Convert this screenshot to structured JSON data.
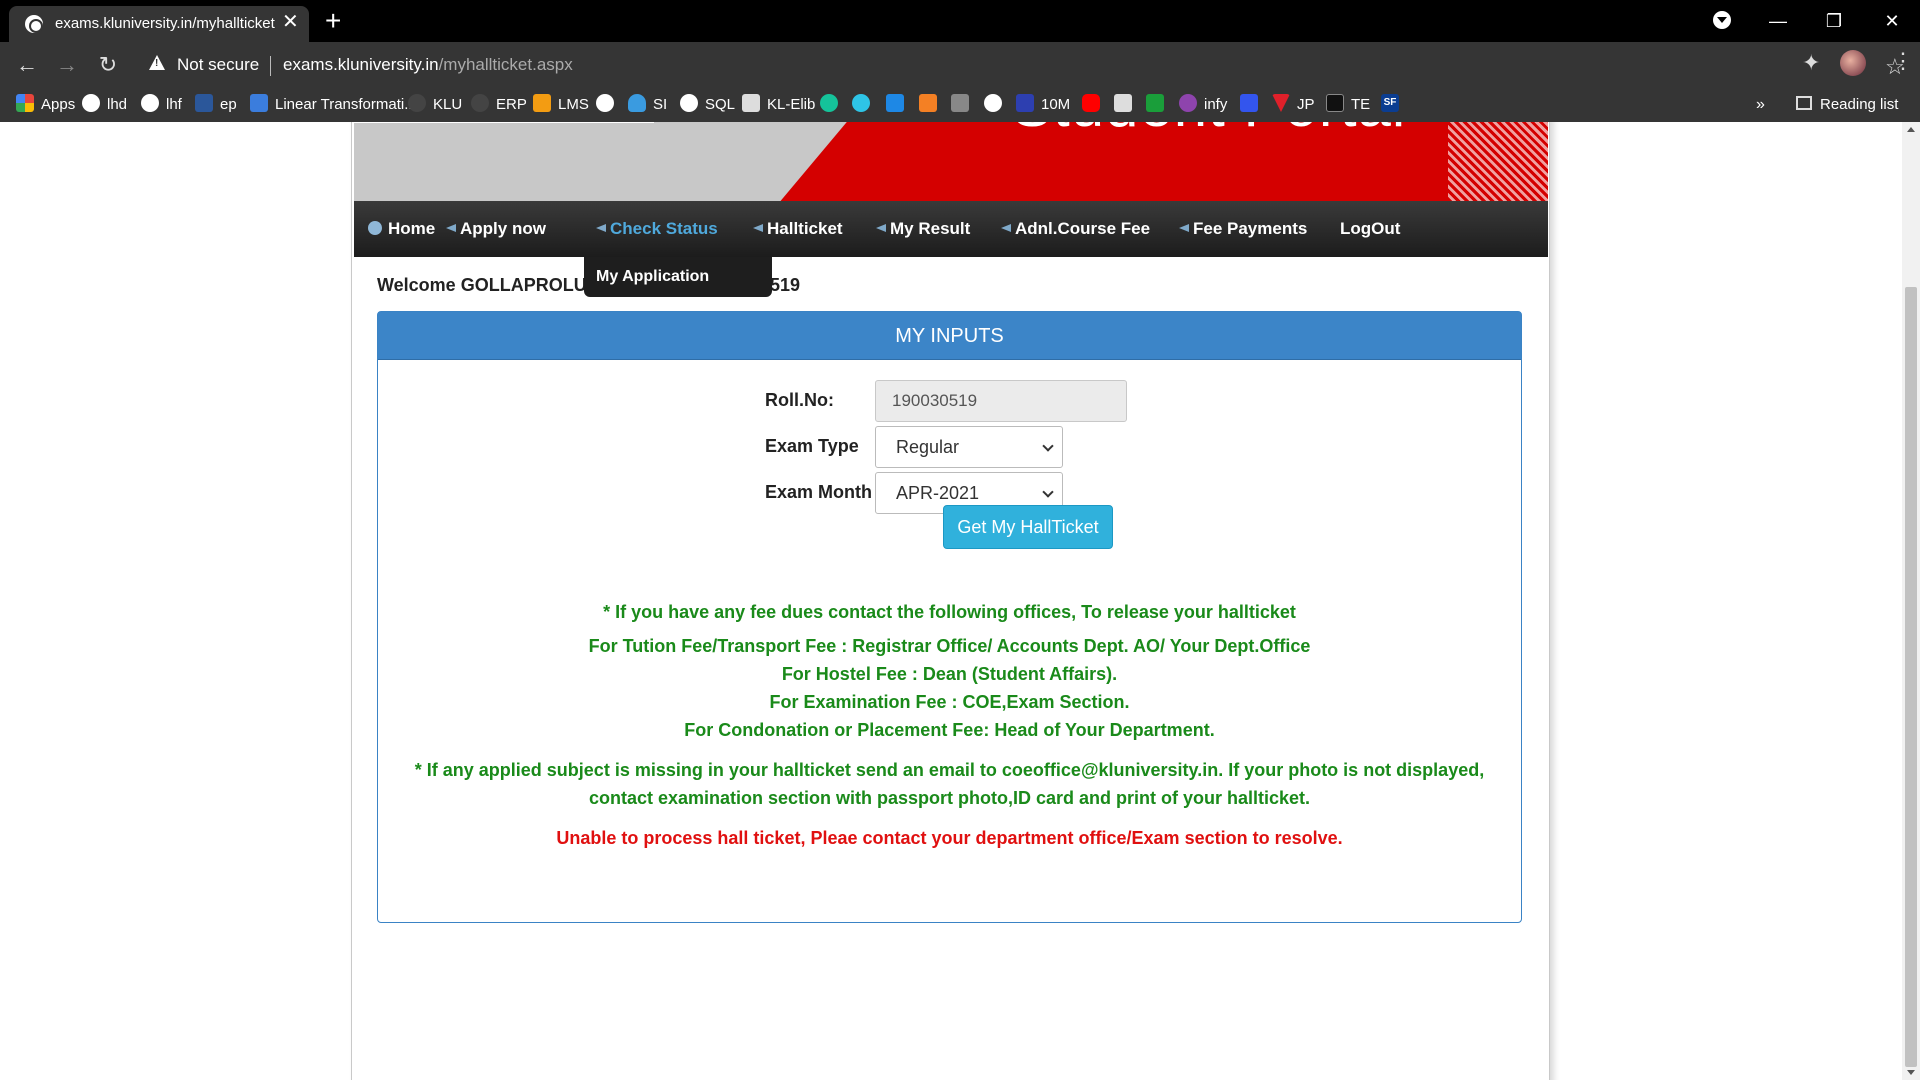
{
  "browser": {
    "tab_title": "exams.kluniversity.in/myhallticket.aspx",
    "close_glyph": "✕",
    "new_tab_glyph": "+",
    "not_secure": "Not secure",
    "url_host": "exams.kluniversity.in",
    "url_path": "/myhallticket.aspx",
    "bookmarks": [
      {
        "label": "Apps",
        "icon": "apps-grid-icon",
        "color": "#e8453c"
      },
      {
        "label": "lhd",
        "icon": "globe-icon",
        "color": "#ffffff"
      },
      {
        "label": "lhf",
        "icon": "globe-icon",
        "color": "#ffffff"
      },
      {
        "label": "ep",
        "icon": "word-icon",
        "color": "#2b579a"
      },
      {
        "label": "Linear Transformati...",
        "icon": "st-icon",
        "color": "#3b7ddd"
      },
      {
        "label": "KLU",
        "icon": "klu-icon",
        "color": "#444444"
      },
      {
        "label": "ERP",
        "icon": "erp-icon",
        "color": "#444444"
      },
      {
        "label": "LMS",
        "icon": "lms-icon",
        "color": "#f39c12"
      },
      {
        "label": "SI",
        "icon": "onedrive-icon",
        "color": "#3a9be0"
      },
      {
        "label": "SQL",
        "icon": "globe-icon",
        "color": "#ffffff"
      },
      {
        "label": "KL-Elib",
        "icon": "elib-icon",
        "color": "#dddddd"
      },
      {
        "label": "10M",
        "icon": "tenm-icon",
        "color": "#2d3fb0"
      },
      {
        "label": "infy",
        "icon": "infy-icon",
        "color": "#8e44ad"
      },
      {
        "label": "JP",
        "icon": "jp-icon",
        "color": "#e0202a"
      },
      {
        "label": "TE",
        "icon": "te-icon",
        "color": "#111111"
      }
    ],
    "bookmark_icons_only": [
      {
        "icon": "grammarly-icon",
        "color": "#15c39a"
      },
      {
        "icon": "chat-icon",
        "color": "#2ec4e6"
      },
      {
        "icon": "box-icon",
        "color": "#1e88e5"
      },
      {
        "icon": "stack-icon",
        "color": "#f48024"
      },
      {
        "icon": "dots-icon",
        "color": "#888888"
      },
      {
        "icon": "globe-icon",
        "color": "#ffffff"
      },
      {
        "icon": "youtube-icon",
        "color": "#ff0000"
      },
      {
        "icon": "hex-icon",
        "color": "#dddddd"
      },
      {
        "icon": "w-icon",
        "color": "#1a9e3a"
      },
      {
        "icon": "pen-icon",
        "color": "#3355ee"
      },
      {
        "icon": "sf-icon",
        "color": "#0b3d91"
      }
    ],
    "sf_label": "SF",
    "overflow": "»",
    "reading_list": "Reading list"
  },
  "portal": {
    "banner_title": "Student Portal",
    "nav": {
      "home": "Home",
      "apply": "Apply now",
      "check_status": "Check Status",
      "hallticket": "Hallticket",
      "my_result": "My Result",
      "course_fee": "Adnl.Course Fee",
      "fee_payments": "Fee Payments",
      "logout": "LogOut"
    },
    "dropdown_item": "My Application",
    "welcome_visible": "Welcome GOLLAPROLU",
    "welcome_tail": "519",
    "panel_title": "MY INPUTS",
    "form": {
      "roll_label": "Roll.No:",
      "roll_value": "190030519",
      "exam_type_label": "Exam Type",
      "exam_type_value": "Regular",
      "exam_month_label": "Exam Month",
      "exam_month_value": "APR-2021",
      "submit_label": "Get My HallTicket"
    },
    "messages": {
      "fee_dues": "* If you have any fee dues contact the following offices, To release your hallticket",
      "tution": "For Tution Fee/Transport Fee : Registrar Office/ Accounts Dept. AO/ Your Dept.Office",
      "hostel": "For Hostel Fee : Dean (Student Affairs).",
      "exam": "For Examination Fee : COE,Exam Section.",
      "condonation": "For Condonation or Placement Fee: Head of Your Department.",
      "missing_line1": "* If any applied subject is missing in your hallticket send an email to coeoffice@kluniversity.in. If your photo is not displayed,",
      "missing_line2": "contact examination section with passport photo,ID card and print of your hallticket.",
      "error": "Unable to process hall ticket, Pleae contact your department office/Exam section to resolve."
    },
    "colors": {
      "panel_header": "#3c85c8",
      "info_green": "#1a8a1a",
      "error_red": "#e01010",
      "submit_button": "#30b1dc",
      "active_nav": "#4fa9dc"
    }
  }
}
